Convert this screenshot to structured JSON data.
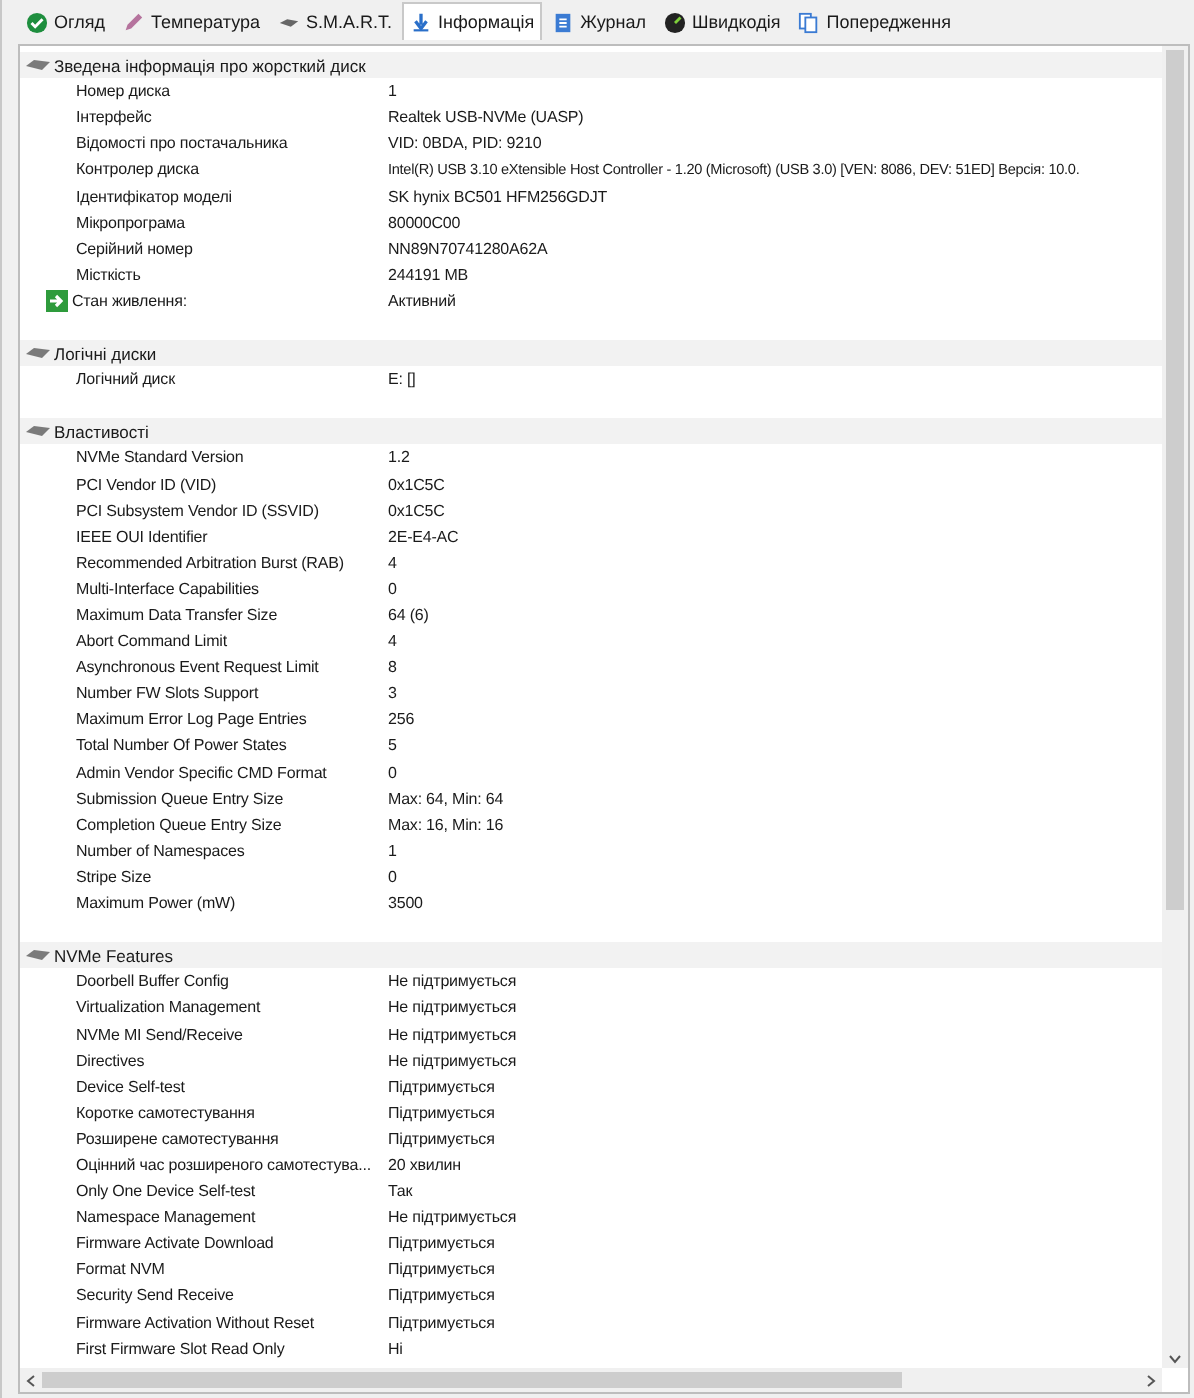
{
  "tabs": [
    {
      "label": "Огляд",
      "selected": false
    },
    {
      "label": "Температура",
      "selected": false
    },
    {
      "label": "S.M.A.R.T.",
      "selected": false
    },
    {
      "label": "Інформація",
      "selected": true
    },
    {
      "label": "Журнал",
      "selected": false
    },
    {
      "label": "Швидкодія",
      "selected": false
    },
    {
      "label": "Попередження",
      "selected": false
    }
  ],
  "sections": [
    {
      "title": "Зведена інформація про жорсткий диск",
      "rows": [
        {
          "kind": "property",
          "label": "Номер диска",
          "value": "1"
        },
        {
          "kind": "property",
          "label": "Інтерфейс",
          "value": "Realtek USB-NVMe (UASP)"
        },
        {
          "kind": "property",
          "label": "Відомості про постачальника",
          "value": "VID: 0BDA, PID: 9210"
        },
        {
          "kind": "property",
          "label": "Контролер диска",
          "value": "Intel(R) USB 3.10 eXtensible Host Controller - 1.20 (Microsoft) (USB 3.0) [VEN: 8086, DEV: 51ED] Версія: 10.0."
        },
        {
          "kind": "property",
          "label": "Ідентифікатор моделі",
          "value": "SK hynix BC501 HFM256GDJT"
        },
        {
          "kind": "property",
          "label": "Мікропрограма",
          "value": "80000C00"
        },
        {
          "kind": "property",
          "label": "Серійний номер",
          "value": "NN89N70741280A62A"
        },
        {
          "kind": "property",
          "label": "Місткість",
          "value": "244191 MB"
        },
        {
          "kind": "status",
          "label": "Стан живлення:",
          "value": "Активний"
        }
      ]
    },
    {
      "title": "Логічні диски",
      "rows": [
        {
          "label": "Логічний диск",
          "value": "E: []"
        }
      ]
    },
    {
      "title": "Властивості",
      "rows": [
        {
          "label": "NVMe Standard Version",
          "value": "1.2"
        },
        {
          "label": "PCI Vendor ID (VID)",
          "value": "0x1C5C"
        },
        {
          "label": "PCI Subsystem Vendor ID (SSVID)",
          "value": "0x1C5C"
        },
        {
          "label": "IEEE OUI Identifier",
          "value": "2E-E4-AC"
        },
        {
          "label": "Recommended Arbitration Burst (RAB)",
          "value": "4"
        },
        {
          "label": "Multi-Interface Capabilities",
          "value": "0"
        },
        {
          "label": "Maximum Data Transfer Size",
          "value": "64 (6)"
        },
        {
          "label": "Abort Command Limit",
          "value": "4"
        },
        {
          "label": "Asynchronous Event Request Limit",
          "value": "8"
        },
        {
          "label": "Number FW Slots Support",
          "value": "3"
        },
        {
          "label": "Maximum Error Log Page Entries",
          "value": "256"
        },
        {
          "label": "Total Number Of Power States",
          "value": "5"
        },
        {
          "label": "Admin Vendor Specific CMD Format",
          "value": "0"
        },
        {
          "label": "Submission Queue Entry Size",
          "value": "Max: 64, Min: 64"
        },
        {
          "label": "Completion Queue Entry Size",
          "value": "Max: 16, Min: 16"
        },
        {
          "label": "Number of Namespaces",
          "value": "1"
        },
        {
          "label": "Stripe Size",
          "value": "0"
        },
        {
          "label": "Maximum Power (mW)",
          "value": "3500"
        }
      ]
    },
    {
      "title": "NVMe Features",
      "rows": [
        {
          "label": "Doorbell Buffer Config",
          "value": "Не підтримується"
        },
        {
          "label": "Virtualization Management",
          "value": "Не підтримується"
        },
        {
          "label": "NVMe MI Send/Receive",
          "value": "Не підтримується"
        },
        {
          "label": "Directives",
          "value": "Не підтримується"
        },
        {
          "label": "Device Self-test",
          "value": "Підтримується"
        },
        {
          "label": "Коротке самотестування",
          "value": "Підтримується"
        },
        {
          "label": "Розширене самотестування",
          "value": "Підтримується"
        },
        {
          "label": "Оцінний час розширеного самотестува...",
          "value": "20 хвилин"
        },
        {
          "label": "Only One Device Self-test",
          "value": "Так"
        },
        {
          "label": "Namespace Management",
          "value": "Не підтримується"
        },
        {
          "label": "Firmware Activate Download",
          "value": "Підтримується"
        },
        {
          "label": "Format NVM",
          "value": "Підтримується"
        },
        {
          "label": "Security Send Receive",
          "value": "Підтримується"
        },
        {
          "label": "Firmware Activation Without Reset",
          "value": "Підтримується"
        },
        {
          "label": "First Firmware Slot Read Only",
          "value": "Ні"
        }
      ]
    }
  ]
}
